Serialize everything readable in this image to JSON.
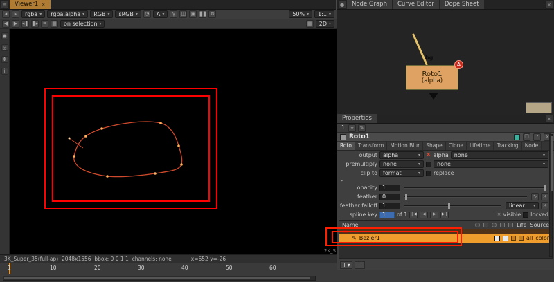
{
  "viewer": {
    "tab": "Viewer1",
    "toolbar": {
      "layer": "rgba",
      "channel": "rgba.alpha",
      "display": "RGB",
      "colorspace": "sRGB",
      "input": "A",
      "zoom": "50%",
      "proxy": "1:1",
      "roi": "on selection",
      "mode": "2D"
    },
    "status": "3K_Super_35(full-ap)  2048x1556  bbox: 0 0 1 1  channels: none",
    "coords": "x=652 y=-26",
    "format_label": "2K_S",
    "ticks": [
      "1",
      "10",
      "20",
      "30",
      "40",
      "50",
      "60"
    ]
  },
  "nodegraph": {
    "tabs": [
      "Node Graph",
      "Curve Editor",
      "Dope Sheet"
    ],
    "node_name": "Roto1",
    "node_sub": "(alpha)",
    "badge": "A",
    "input_label": "bg"
  },
  "properties": {
    "tab": "Properties",
    "count": "1",
    "title": "Roto1",
    "tabs": [
      "Roto",
      "Transform",
      "Motion Blur",
      "Shape",
      "Clone",
      "Lifetime",
      "Tracking",
      "Node"
    ],
    "output": {
      "label": "output",
      "value": "alpha",
      "channel": "alpha",
      "extra": "none"
    },
    "premultiply": {
      "label": "premultiply",
      "value": "none",
      "extra": "none"
    },
    "clipto": {
      "label": "clip to",
      "value": "format",
      "replace": "replace"
    },
    "opacity": {
      "label": "opacity",
      "value": "1"
    },
    "feather": {
      "label": "feather",
      "value": "0"
    },
    "falloff": {
      "label": "feather falloff",
      "value": "1",
      "type": "linear"
    },
    "splinekey": {
      "label": "spline key",
      "value": "1",
      "of": "of 1"
    },
    "flags": {
      "visible": "visible",
      "locked": "locked"
    },
    "list": {
      "name": "Name",
      "life": "Life",
      "source": "Source",
      "row": {
        "name": "Bezier1",
        "life": "all",
        "source": "color"
      }
    },
    "add_label": "+",
    "remove_label": "−"
  },
  "colors": {
    "accent_orange": "#ef9e2e",
    "annotation_red": "#ff1f00",
    "node_fill": "#dfa263",
    "selection_blue": "#3d6db0",
    "format_outline_red": "#ff0000"
  }
}
